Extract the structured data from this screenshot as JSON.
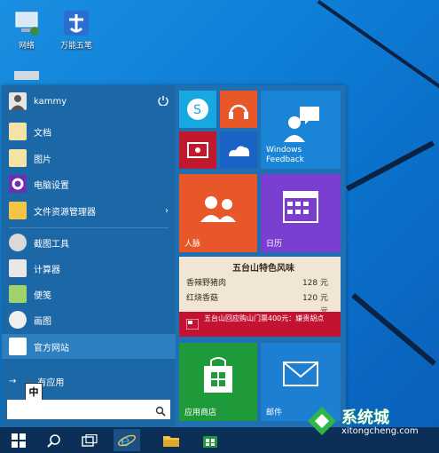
{
  "desktop": {
    "icons": [
      {
        "label": "网络",
        "icon": "network-icon"
      },
      {
        "label": "万能五笔",
        "icon": "wanneng-wubi-icon"
      }
    ]
  },
  "start_menu": {
    "user": {
      "name": "kammy",
      "power_icon": "power-icon"
    },
    "items": [
      {
        "label": "文档",
        "icon": "documents-icon"
      },
      {
        "label": "图片",
        "icon": "pictures-icon"
      },
      {
        "label": "电脑设置",
        "icon": "settings-gear-icon"
      },
      {
        "label": "文件资源管理器",
        "icon": "file-explorer-icon",
        "arrow": "›"
      },
      {
        "label": "截图工具",
        "icon": "snipping-tool-icon"
      },
      {
        "label": "计算器",
        "icon": "calculator-icon"
      },
      {
        "label": "便笺",
        "icon": "sticky-notes-icon"
      },
      {
        "label": "画图",
        "icon": "paint-icon"
      },
      {
        "label": "官方网站",
        "icon": "official-site-icon"
      },
      {
        "label": "所有应用",
        "icon": "arrow-right-icon",
        "partial": "有应用"
      }
    ],
    "ime_label": "中",
    "search": {
      "placeholder": "",
      "icon": "search-icon"
    }
  },
  "tiles": [
    {
      "label": "",
      "icon": "skype-icon",
      "color": "#17a7e1"
    },
    {
      "label": "",
      "icon": "headphones-icon",
      "color": "#e8572a"
    },
    {
      "label": "",
      "icon": "video-icon",
      "color": "#c0192e"
    },
    {
      "label": "",
      "icon": "onedrive-icon",
      "color": "#1b62c6"
    },
    {
      "label": "Windows Feedback",
      "icon": "feedback-icon",
      "color": "#1a85d6"
    },
    {
      "label": "人脉",
      "icon": "people-icon",
      "color": "#e8572a"
    },
    {
      "label": "日历",
      "icon": "calendar-icon",
      "color": "#7a3ed0"
    },
    {
      "label": "五台山特色风味",
      "items": [
        {
          "name": "香辣野猪肉",
          "price": "128 元"
        },
        {
          "name": "红烧香菇",
          "price": "120 元"
        },
        {
          "name": "",
          "price": "元"
        }
      ],
      "color": "#f1e6d4"
    },
    {
      "label": "五台山回应购山门票400元：嫌贵胡点",
      "icon": "news-icon",
      "color": "#c41233"
    },
    {
      "label": "应用商店",
      "icon": "store-icon",
      "color": "#1f9a3a"
    },
    {
      "label": "邮件",
      "icon": "mail-icon",
      "color": "#1c7fd1"
    }
  ],
  "taskbar": {
    "buttons": [
      {
        "name": "start",
        "icon": "windows-logo-icon"
      },
      {
        "name": "search",
        "icon": "search-icon"
      },
      {
        "name": "task-view",
        "icon": "task-view-icon"
      },
      {
        "name": "ie",
        "icon": "internet-explorer-icon"
      },
      {
        "name": "explorer",
        "icon": "folder-icon"
      },
      {
        "name": "store",
        "icon": "store-icon"
      }
    ]
  },
  "watermark": {
    "brand": "系统城",
    "url": "xitongcheng.com"
  }
}
